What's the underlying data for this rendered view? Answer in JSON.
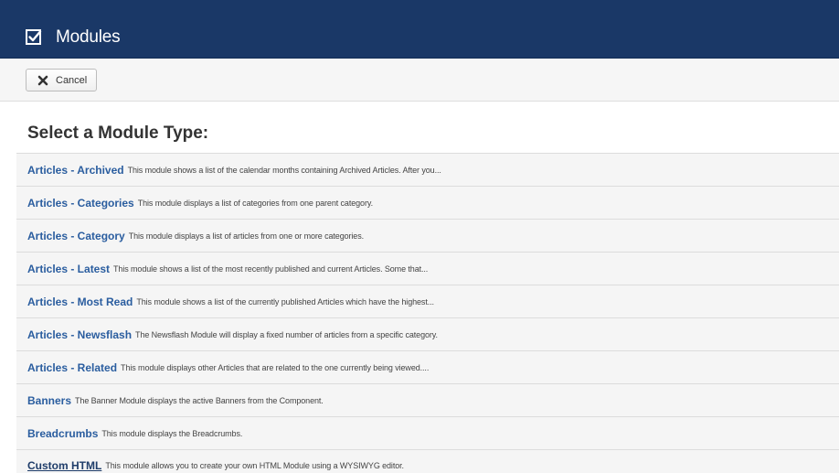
{
  "header": {
    "title": "Modules",
    "icon": "checkbox-icon",
    "background": "#1a3867"
  },
  "toolbar": {
    "cancel_label": "Cancel",
    "cancel_icon": "close-icon"
  },
  "main": {
    "heading": "Select a Module Type:",
    "modules": [
      {
        "name": "Articles - Archived",
        "description": "This module shows a list of the calendar months containing Archived Articles. After you..."
      },
      {
        "name": "Articles - Categories",
        "description": "This module displays a list of categories from one parent category."
      },
      {
        "name": "Articles - Category",
        "description": "This module displays a list of articles from one or more categories."
      },
      {
        "name": "Articles - Latest",
        "description": "This module shows a list of the most recently published and current Articles. Some that..."
      },
      {
        "name": "Articles - Most Read",
        "description": "This module shows a list of the currently published Articles which have the highest..."
      },
      {
        "name": "Articles - Newsflash",
        "description": "The Newsflash Module will display a fixed number of articles from a specific category."
      },
      {
        "name": "Articles - Related",
        "description": "This module displays other Articles that are related to the one currently being viewed...."
      },
      {
        "name": "Banners",
        "description": "The Banner Module displays the active Banners from the Component."
      },
      {
        "name": "Breadcrumbs",
        "description": "This module displays the Breadcrumbs."
      },
      {
        "name": "Custom HTML",
        "description": "This module allows you to create your own HTML Module using a WYSIWYG editor."
      }
    ]
  },
  "colors": {
    "link": "#2a5d9f",
    "hovered_link": "#1f3d6a",
    "row_background": "#f5f5f5"
  }
}
